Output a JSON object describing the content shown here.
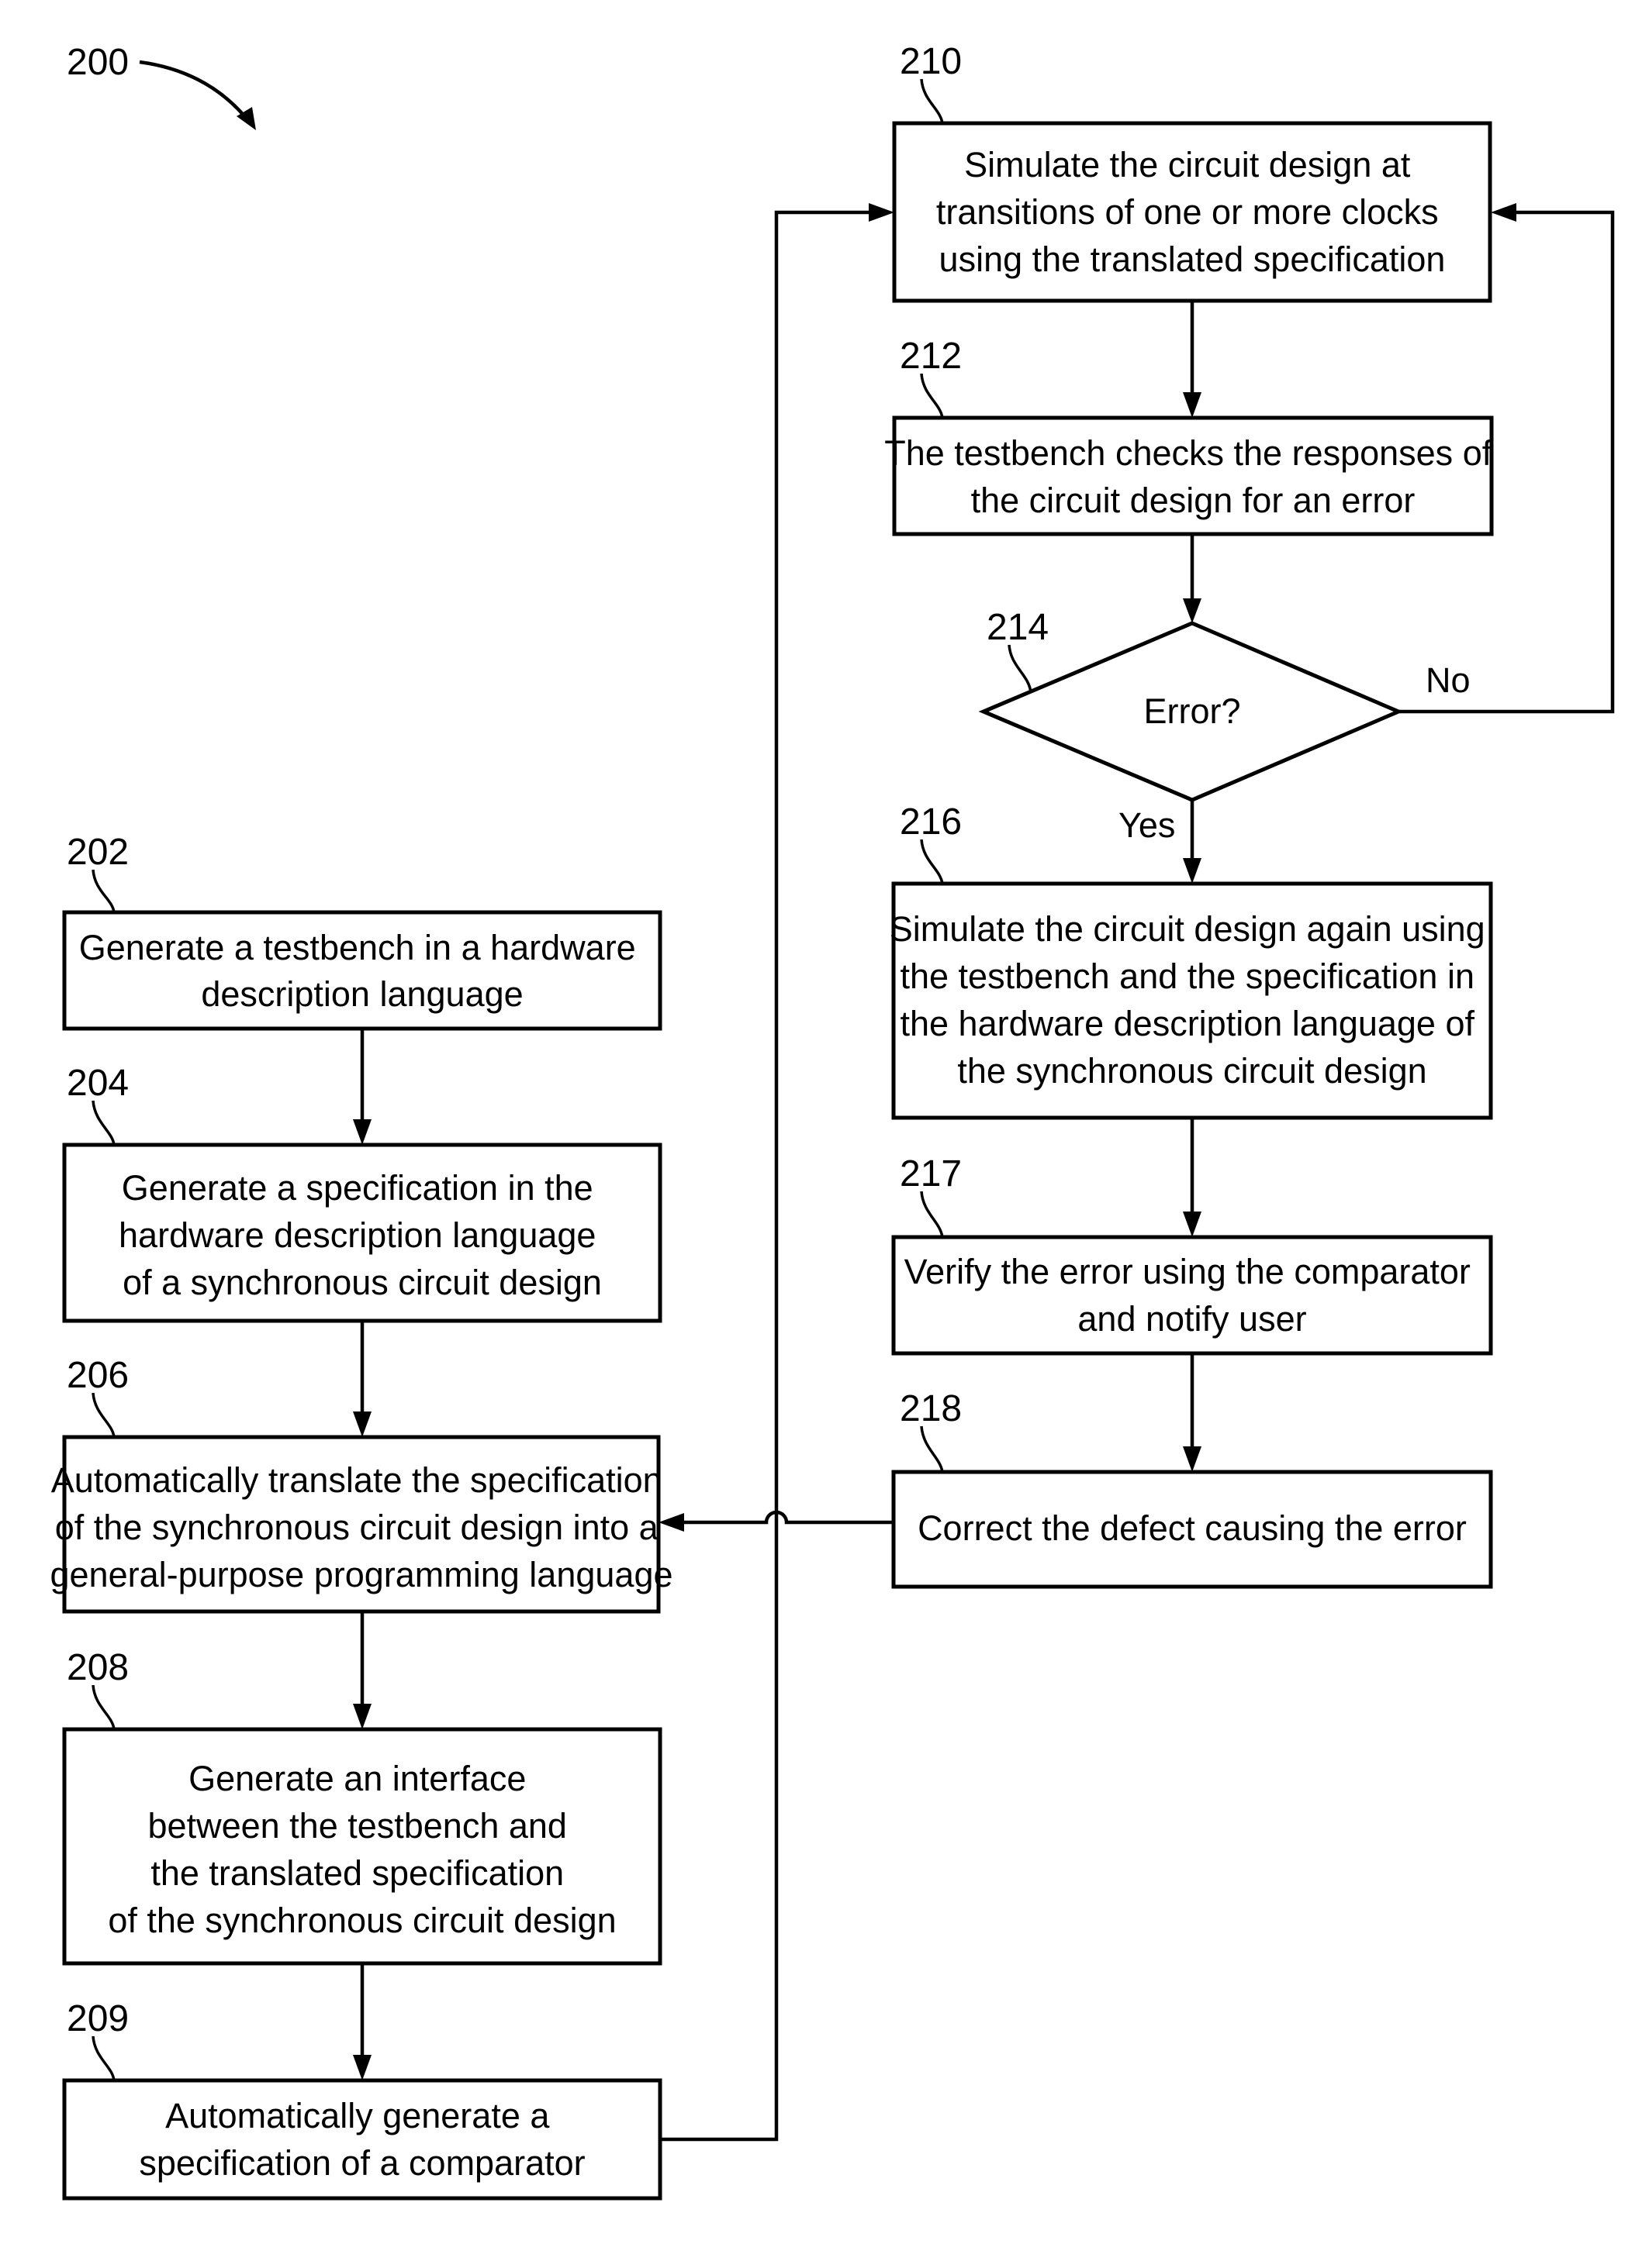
{
  "figure": {
    "ref": "200"
  },
  "steps": {
    "s202": {
      "ref": "202",
      "lines": [
        "Generate a testbench in a hardware",
        "description language"
      ]
    },
    "s204": {
      "ref": "204",
      "lines": [
        "Generate a specification in the",
        "hardware description language",
        "of a synchronous circuit design"
      ]
    },
    "s206": {
      "ref": "206",
      "lines": [
        "Automatically translate the specification",
        "of the synchronous circuit design into a",
        "general-purpose programming language"
      ]
    },
    "s208": {
      "ref": "208",
      "lines": [
        "Generate an interface",
        "between the testbench and",
        "the translated specification",
        "of the synchronous circuit design"
      ]
    },
    "s209": {
      "ref": "209",
      "lines": [
        "Automatically generate a",
        "specification of a comparator"
      ]
    },
    "s210": {
      "ref": "210",
      "lines": [
        "Simulate the circuit design at",
        "transitions of one or more clocks",
        "using the translated specification"
      ]
    },
    "s212": {
      "ref": "212",
      "lines": [
        "The testbench checks the responses of",
        "the circuit design for an error"
      ]
    },
    "s214": {
      "ref": "214",
      "lines": [
        "Error?"
      ],
      "yes_label": "Yes",
      "no_label": "No"
    },
    "s216": {
      "ref": "216",
      "lines": [
        "Simulate the circuit design again using",
        "the testbench and the specification in",
        "the hardware description language of",
        "the synchronous circuit design"
      ]
    },
    "s217": {
      "ref": "217",
      "lines": [
        "Verify the error using the comparator",
        "and notify user"
      ]
    },
    "s218": {
      "ref": "218",
      "lines": [
        "Correct the defect causing the error"
      ]
    }
  }
}
